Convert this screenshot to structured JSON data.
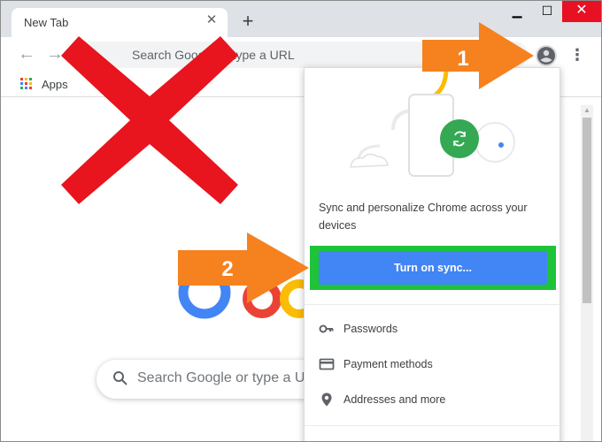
{
  "tab": {
    "title": "New Tab",
    "close_glyph": "✕"
  },
  "newtab_glyph": "+",
  "window_controls": {
    "minimize": "▁",
    "maximize": "☐",
    "close": "✕"
  },
  "omnibox": {
    "placeholder": "Search Google or type a URL"
  },
  "bookmarks": {
    "apps_label": "Apps"
  },
  "ntp": {
    "search_text": "Search Google or type a URL"
  },
  "popup": {
    "description": "Sync and personalize Chrome across your devices",
    "sync_button": "Turn on sync...",
    "items": [
      {
        "label": "Passwords",
        "icon": "key-icon"
      },
      {
        "label": "Payment methods",
        "icon": "credit-card-icon"
      },
      {
        "label": "Addresses and more",
        "icon": "location-pin-icon"
      }
    ]
  },
  "annotations": {
    "arrow1_label": "1",
    "arrow2_label": "2",
    "arrow_color": "#f5821f",
    "cross_color": "#e8141e",
    "highlight_color": "#1fc33a"
  },
  "colors": {
    "sync_blue": "#4285f4",
    "tabstrip": "#dee1e6",
    "close_red": "#e81123"
  }
}
